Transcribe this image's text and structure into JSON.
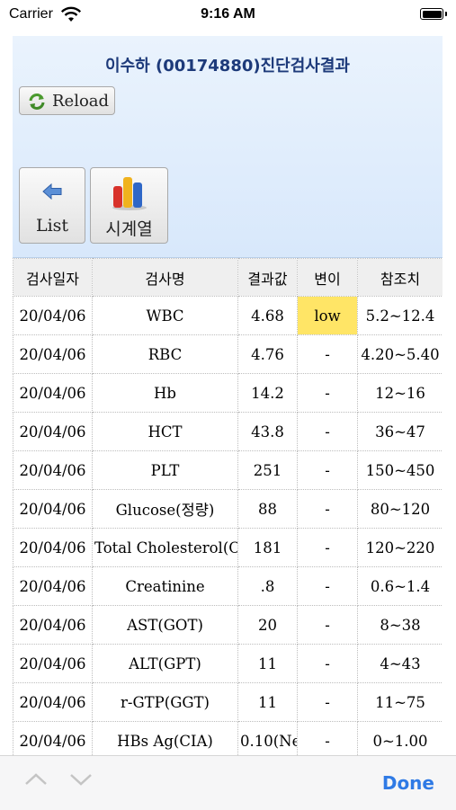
{
  "status_bar": {
    "carrier": "Carrier",
    "time": "9:16 AM"
  },
  "header": {
    "title": "이수하 (00174880)진단검사결과",
    "reload_label": "Reload",
    "list_label": "List",
    "series_label": "시계열"
  },
  "table": {
    "columns": [
      "검사일자",
      "검사명",
      "결과값",
      "변이",
      "참조치"
    ],
    "rows": [
      {
        "date": "20/04/06",
        "test": "WBC",
        "result": "4.68",
        "flag": "low",
        "ref": "5.2~12.4"
      },
      {
        "date": "20/04/06",
        "test": "RBC",
        "result": "4.76",
        "flag": "-",
        "ref": "4.20~5.40"
      },
      {
        "date": "20/04/06",
        "test": "Hb",
        "result": "14.2",
        "flag": "-",
        "ref": "12~16"
      },
      {
        "date": "20/04/06",
        "test": "HCT",
        "result": "43.8",
        "flag": "-",
        "ref": "36~47"
      },
      {
        "date": "20/04/06",
        "test": "PLT",
        "result": "251",
        "flag": "-",
        "ref": "150~450"
      },
      {
        "date": "20/04/06",
        "test": "Glucose(정량)",
        "result": "88",
        "flag": "-",
        "ref": "80~120"
      },
      {
        "date": "20/04/06",
        "test": "Total Cholesterol(CH",
        "result": "181",
        "flag": "-",
        "ref": "120~220"
      },
      {
        "date": "20/04/06",
        "test": "Creatinine",
        "result": ".8",
        "flag": "-",
        "ref": "0.6~1.4"
      },
      {
        "date": "20/04/06",
        "test": "AST(GOT)",
        "result": "20",
        "flag": "-",
        "ref": "8~38"
      },
      {
        "date": "20/04/06",
        "test": "ALT(GPT)",
        "result": "11",
        "flag": "-",
        "ref": "4~43"
      },
      {
        "date": "20/04/06",
        "test": "r-GTP(GGT)",
        "result": "11",
        "flag": "-",
        "ref": "11~75"
      },
      {
        "date": "20/04/06",
        "test": "HBs Ag(CIA)",
        "result": "0.10(Ne",
        "flag": "-",
        "ref": "0~1.00"
      }
    ]
  },
  "toolbar": {
    "done_label": "Done"
  },
  "colors": {
    "title": "#1d3a7a",
    "low_highlight": "#ffe566",
    "done": "#2f7ae5",
    "header_bg": "#dde9fb"
  },
  "icons": [
    "wifi-icon",
    "battery-icon",
    "reload-icon",
    "back-arrow-icon",
    "bar-chart-icon",
    "chevron-up-icon",
    "chevron-down-icon"
  ]
}
